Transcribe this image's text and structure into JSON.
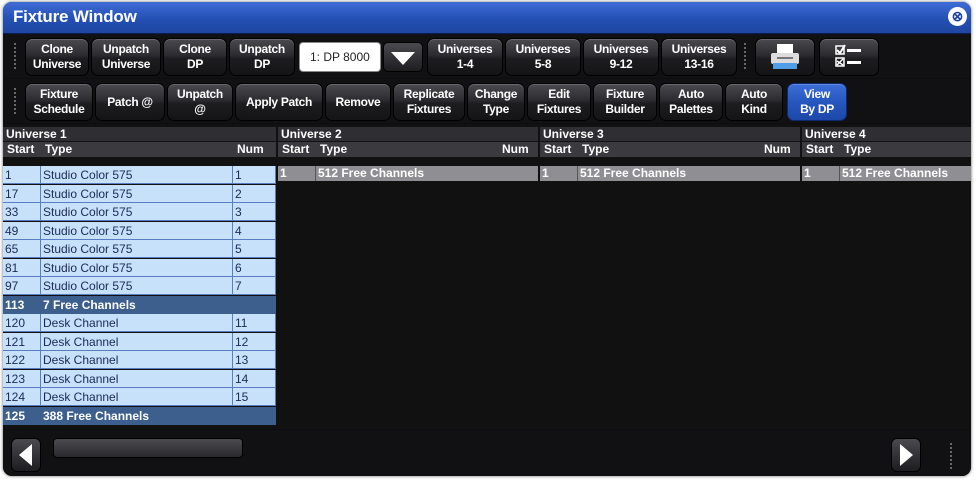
{
  "window": {
    "title": "Fixture Window",
    "close_glyph": "⊗"
  },
  "toolbar1": {
    "clone_universe": [
      "Clone",
      "Universe"
    ],
    "unpatch_universe": [
      "Unpatch",
      "Universe"
    ],
    "clone_dp": [
      "Clone",
      "DP"
    ],
    "unpatch_dp": [
      "Unpatch",
      "DP"
    ],
    "dp_select_value": "1: DP 8000",
    "universes_1_4": [
      "Universes",
      "1-4"
    ],
    "universes_5_8": [
      "Universes",
      "5-8"
    ],
    "universes_9_12": [
      "Universes",
      "9-12"
    ],
    "universes_13_16": [
      "Universes",
      "13-16"
    ],
    "print_icon": "printer-icon",
    "checklist_icon": "checklist-icon"
  },
  "toolbar2": {
    "fixture_schedule": [
      "Fixture",
      "Schedule"
    ],
    "patch_at": "Patch @",
    "unpatch_at": [
      "Unpatch",
      "@"
    ],
    "apply_patch": "Apply Patch",
    "remove": "Remove",
    "replicate_fixtures": [
      "Replicate",
      "Fixtures"
    ],
    "change_type": [
      "Change",
      "Type"
    ],
    "edit_fixtures": [
      "Edit",
      "Fixtures"
    ],
    "fixture_builder": [
      "Fixture",
      "Builder"
    ],
    "auto_palettes": [
      "Auto",
      "Palettes"
    ],
    "auto_kind": [
      "Auto",
      "Kind"
    ],
    "view_by_dp": [
      "View",
      "By DP"
    ]
  },
  "universes": [
    {
      "title": "Universe 1",
      "col_start": "Start",
      "col_type": "Type",
      "col_num": "Num",
      "rows": [
        {
          "start": "1",
          "type": "Studio Color 575",
          "num": "1",
          "kind": "fixture"
        },
        {
          "start": "17",
          "type": "Studio Color 575",
          "num": "2",
          "kind": "fixture"
        },
        {
          "start": "33",
          "type": "Studio Color 575",
          "num": "3",
          "kind": "fixture"
        },
        {
          "start": "49",
          "type": "Studio Color 575",
          "num": "4",
          "kind": "fixture"
        },
        {
          "start": "65",
          "type": "Studio Color 575",
          "num": "5",
          "kind": "fixture"
        },
        {
          "start": "81",
          "type": "Studio Color 575",
          "num": "6",
          "kind": "fixture"
        },
        {
          "start": "97",
          "type": "Studio Color 575",
          "num": "7",
          "kind": "fixture"
        },
        {
          "start": "113",
          "type": "7 Free Channels",
          "num": "",
          "kind": "free"
        },
        {
          "start": "120",
          "type": "Desk Channel",
          "num": "11",
          "kind": "fixture"
        },
        {
          "start": "121",
          "type": "Desk Channel",
          "num": "12",
          "kind": "fixture"
        },
        {
          "start": "122",
          "type": "Desk Channel",
          "num": "13",
          "kind": "fixture"
        },
        {
          "start": "123",
          "type": "Desk Channel",
          "num": "14",
          "kind": "fixture"
        },
        {
          "start": "124",
          "type": "Desk Channel",
          "num": "15",
          "kind": "fixture"
        },
        {
          "start": "125",
          "type": "388 Free Channels",
          "num": "",
          "kind": "free"
        }
      ]
    },
    {
      "title": "Universe 2",
      "col_start": "Start",
      "col_type": "Type",
      "col_num": "Num",
      "rows": [
        {
          "start": "1",
          "type": "512 Free Channels",
          "num": "",
          "kind": "gray"
        }
      ]
    },
    {
      "title": "Universe 3",
      "col_start": "Start",
      "col_type": "Type",
      "col_num": "Num",
      "rows": [
        {
          "start": "1",
          "type": "512 Free Channels",
          "num": "",
          "kind": "gray"
        }
      ]
    },
    {
      "title": "Universe 4",
      "col_start": "Start",
      "col_type": "Type",
      "col_num": "",
      "rows": [
        {
          "start": "1",
          "type": "512 Free Channels",
          "num": "",
          "kind": "gray"
        }
      ]
    }
  ],
  "scrollbar": {
    "left_icon": "arrow-left-icon",
    "right_icon": "arrow-right-icon"
  },
  "colors": {
    "titlebar": "#2450b4",
    "fixture_row": "#c7e1fb",
    "free_row": "#3d5f8e",
    "gray_row": "#8f8f93"
  }
}
